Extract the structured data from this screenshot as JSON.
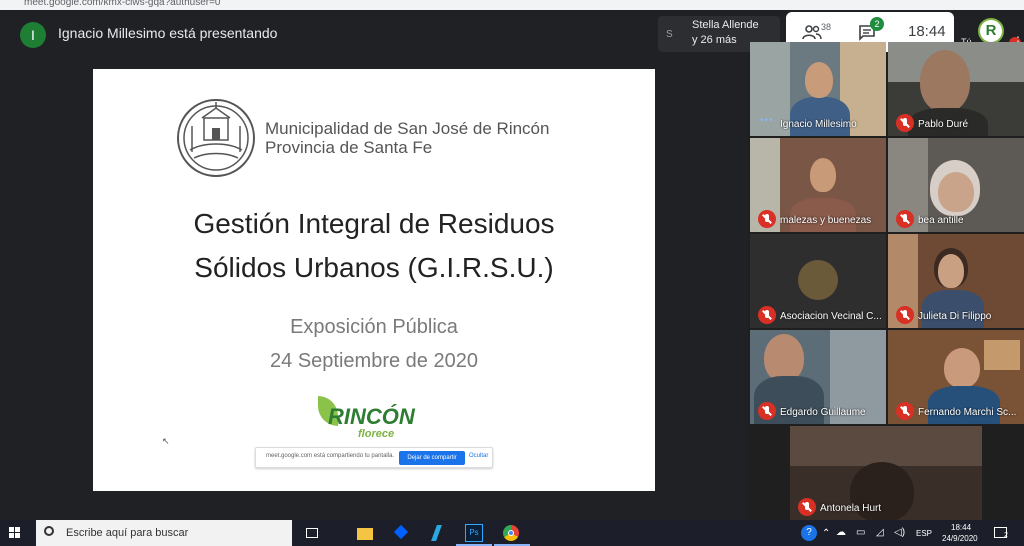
{
  "browser": {
    "url": "meet.google.com/kmx-ciws-gqa?authuser=0"
  },
  "meet": {
    "presenter_initial": "I",
    "presenting_text": "Ignacio Millesimo está presentando",
    "others_initial": "S",
    "others_line1": "Stella Allende",
    "others_line2": "y 26 más",
    "participants_count": "38",
    "chat_count": "2",
    "clock": "18:44",
    "me_label": "Tú",
    "me_logo": "R"
  },
  "slide": {
    "muni_line1": "Municipalidad de San José de Rincón",
    "muni_line2": "Provincia de Santa Fe",
    "title_line1": "Gestión Integral de Residuos",
    "title_line2": "Sólidos Urbanos (G.I.R.S.U.)",
    "subtitle_line1": "Exposición Pública",
    "subtitle_line2": "24 Septiembre de 2020",
    "logo_main": "RINCÓN",
    "logo_sub": "florece"
  },
  "share_bar": {
    "text": "meet.google.com está compartiendo tu pantalla.",
    "stop_label": "Dejar de compartir",
    "hide_label": "Ocultar"
  },
  "participants": [
    {
      "name": "Ignacio Millesimo",
      "muted": false
    },
    {
      "name": "Pablo Duré",
      "muted": true
    },
    {
      "name": "malezas y buenezas",
      "muted": true
    },
    {
      "name": "bea antille",
      "muted": true
    },
    {
      "name": "Asociacion Vecinal C...",
      "muted": true
    },
    {
      "name": "Julieta Di Filippo",
      "muted": true
    },
    {
      "name": "Edgardo Guillaume",
      "muted": true
    },
    {
      "name": "Fernando Marchi Sc...",
      "muted": true
    },
    {
      "name": "Antonela Hurt",
      "muted": true
    }
  ],
  "taskbar": {
    "search_placeholder": "Escribe aquí para buscar",
    "language": "ESP",
    "time": "18:44",
    "date": "24/9/2020",
    "notifications": "2"
  }
}
